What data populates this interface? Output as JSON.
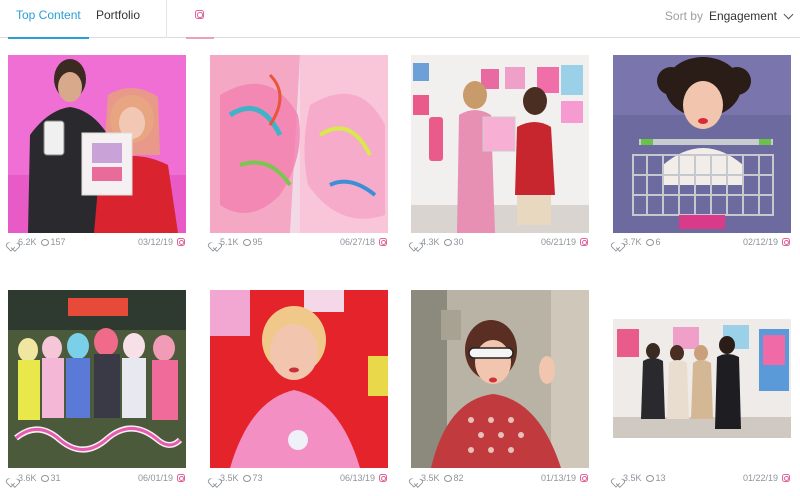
{
  "tabs": {
    "top_content": "Top Content",
    "portfolio": "Portfolio"
  },
  "sort": {
    "label": "Sort by",
    "value": "Engagement"
  },
  "accent_color": "#2a9fd6",
  "instagram_color": "#e0659b",
  "posts": [
    {
      "likes": "6.2K",
      "comments": "157",
      "date": "03/12/19",
      "icon": "instagram-icon"
    },
    {
      "likes": "5.1K",
      "comments": "95",
      "date": "06/27/18",
      "icon": "instagram-icon"
    },
    {
      "likes": "4.3K",
      "comments": "30",
      "date": "06/21/19",
      "icon": "instagram-icon"
    },
    {
      "likes": "3.7K",
      "comments": "6",
      "date": "02/12/19",
      "icon": "instagram-icon"
    },
    {
      "likes": "3.6K",
      "comments": "31",
      "date": "06/01/19",
      "icon": "instagram-icon"
    },
    {
      "likes": "3.5K",
      "comments": "73",
      "date": "06/13/19",
      "icon": "instagram-icon"
    },
    {
      "likes": "3.5K",
      "comments": "82",
      "date": "01/13/19",
      "icon": "instagram-icon"
    },
    {
      "likes": "3.5K",
      "comments": "13",
      "date": "01/22/19",
      "icon": "instagram-icon"
    }
  ]
}
